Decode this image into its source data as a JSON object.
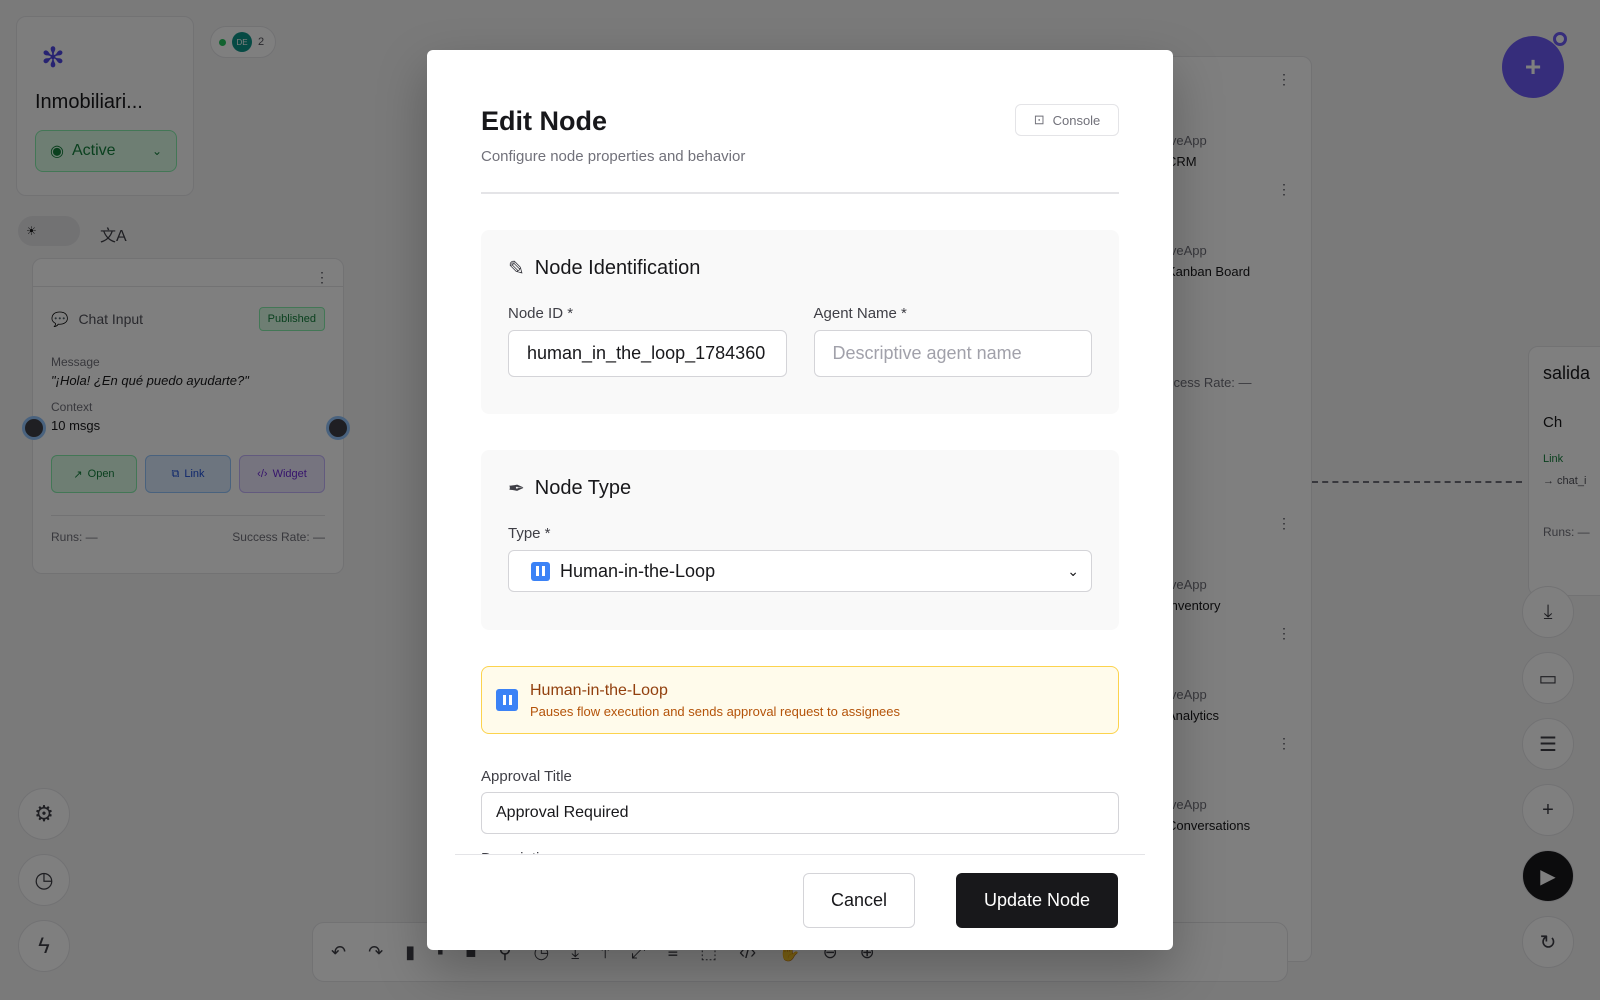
{
  "workspace": {
    "name": "Inmobiliari...",
    "status": "Active",
    "presence_initials": "DE",
    "presence_count": "2"
  },
  "chat_node": {
    "title": "Chat Input",
    "badge": "Published",
    "message_label": "Message",
    "message_value": "\"¡Hola! ¿En qué puedo ayudarte?\"",
    "context_label": "Context",
    "context_value": "10 msgs",
    "open_label": "Open",
    "link_label": "Link",
    "widget_label": "Widget",
    "runs": "Runs: —",
    "success_rate": "Success Rate: —"
  },
  "right_nodes": [
    {
      "app": "iveApp",
      "name": "CRM"
    },
    {
      "app": "iveApp",
      "name": "Kanban Board"
    },
    {
      "app": "iveApp",
      "name": "Inventory"
    },
    {
      "app": "iveApp",
      "name": "Analytics"
    },
    {
      "app": "iveApp",
      "name": "Conversations"
    }
  ],
  "right_col_success": "ccess Rate: —",
  "salida": {
    "title": "salida",
    "item": "Ch",
    "link": "Link",
    "sub": "→ chat_i",
    "runs": "Runs: —"
  },
  "modal": {
    "title": "Edit Node",
    "subtitle": "Configure node properties and behavior",
    "console_label": "Console",
    "identification": {
      "heading": "Node Identification",
      "node_id_label": "Node ID *",
      "node_id_value": "human_in_the_loop_1784360",
      "agent_name_label": "Agent Name *",
      "agent_name_placeholder": "Descriptive agent name"
    },
    "type_section": {
      "heading": "Node Type",
      "type_label": "Type *",
      "type_value": "Human-in-the-Loop"
    },
    "info": {
      "title": "Human-in-the-Loop",
      "description": "Pauses flow execution and sends approval request to assignees"
    },
    "approval_title_label": "Approval Title",
    "approval_title_value": "Approval Required",
    "description_label": "Description",
    "cancel_label": "Cancel",
    "update_label": "Update Node"
  },
  "colors": {
    "accent": "#6d5bf6",
    "primary_button": "#18181b",
    "success": "#15803d",
    "warning_text": "#92400e"
  }
}
